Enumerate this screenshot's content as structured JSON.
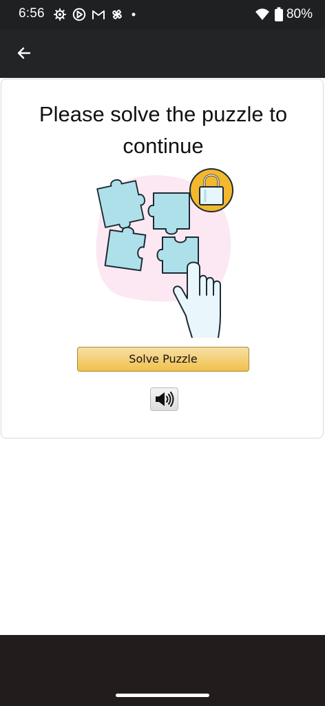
{
  "status_bar": {
    "time": "6:56",
    "battery": "80%",
    "icons": [
      "settings-icon",
      "play-circle-icon",
      "gmail-icon",
      "pinwheel-icon",
      "dot-icon",
      "wifi-icon",
      "battery-icon"
    ]
  },
  "app_bar": {
    "back_icon": "arrow-left-icon"
  },
  "content": {
    "title": "Please solve the puzzle to continue",
    "illustration": "puzzle-lock-hand-illustration",
    "solve_button_label": "Solve Puzzle",
    "audio_icon": "speaker-icon"
  },
  "colors": {
    "status_bar_bg": "#1f2022",
    "app_bar_bg": "#222426",
    "button_gradient_top": "#f7dfa5",
    "button_gradient_bottom": "#f0c14b",
    "puzzle_blue": "#aee0ea",
    "lock_gold": "#f3b82d",
    "blob_pink": "#fbe8f2",
    "nav_bar_bg": "#231c1c"
  }
}
